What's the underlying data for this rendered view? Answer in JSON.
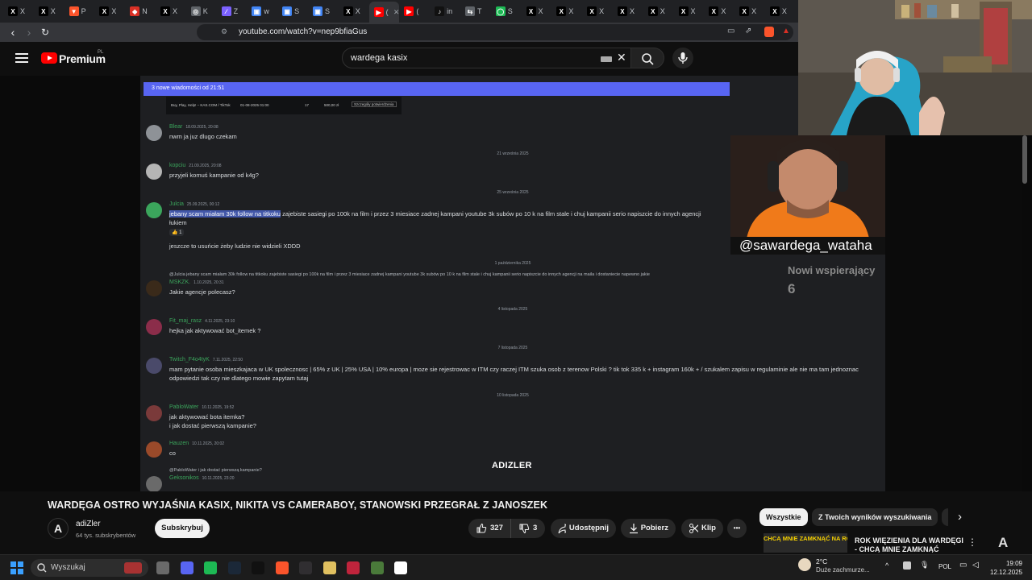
{
  "browser": {
    "tabs": [
      {
        "icon": "x-icon",
        "label": "X",
        "color": "#000000",
        "glyph": "X"
      },
      {
        "icon": "x-icon",
        "label": "X",
        "color": "#000000",
        "glyph": "X"
      },
      {
        "icon": "brave-icon",
        "label": "P",
        "color": "#fb542b",
        "glyph": "▼"
      },
      {
        "icon": "x-icon",
        "label": "X",
        "color": "#000000",
        "glyph": "X"
      },
      {
        "icon": "shield-icon",
        "label": "N",
        "color": "#d93025",
        "glyph": "◆"
      },
      {
        "icon": "x-icon",
        "label": "X",
        "color": "#000000",
        "glyph": "X"
      },
      {
        "icon": "globe-icon",
        "label": "K",
        "color": "#5f6368",
        "glyph": "◎"
      },
      {
        "icon": "pencil-icon",
        "label": "Z",
        "color": "#7b61ff",
        "glyph": "∕"
      },
      {
        "icon": "tool-icon",
        "label": "w",
        "color": "#4285f4",
        "glyph": "▣"
      },
      {
        "icon": "tool-icon",
        "label": "S",
        "color": "#4285f4",
        "glyph": "▣"
      },
      {
        "icon": "tool-icon",
        "label": "S",
        "color": "#4285f4",
        "glyph": "▣"
      },
      {
        "icon": "x-icon",
        "label": "X",
        "color": "#000000",
        "glyph": "X"
      },
      {
        "icon": "youtube-icon",
        "label": "(",
        "color": "#ff0000",
        "glyph": "▶",
        "active": true
      },
      {
        "icon": "youtube-icon",
        "label": "(",
        "color": "#ff0000",
        "glyph": "▶"
      },
      {
        "icon": "tiktok-icon",
        "label": "in",
        "color": "#111111",
        "glyph": "♪"
      },
      {
        "icon": "arrows-icon",
        "label": "T",
        "color": "#5f6368",
        "glyph": "⇆"
      },
      {
        "icon": "circle-icon",
        "label": "S",
        "color": "#1db954",
        "glyph": "◯"
      },
      {
        "icon": "x-icon",
        "label": "X",
        "color": "#000000",
        "glyph": "X"
      },
      {
        "icon": "x-icon",
        "label": "X",
        "color": "#000000",
        "glyph": "X"
      },
      {
        "icon": "x-icon",
        "label": "X",
        "color": "#000000",
        "glyph": "X"
      },
      {
        "icon": "x-icon",
        "label": "X",
        "color": "#000000",
        "glyph": "X"
      },
      {
        "icon": "x-icon",
        "label": "X",
        "color": "#000000",
        "glyph": "X"
      },
      {
        "icon": "x-icon",
        "label": "X",
        "color": "#000000",
        "glyph": "X"
      },
      {
        "icon": "x-icon",
        "label": "X",
        "color": "#000000",
        "glyph": "X"
      },
      {
        "icon": "x-icon",
        "label": "X",
        "color": "#000000",
        "glyph": "X"
      },
      {
        "icon": "x-icon",
        "label": "X",
        "color": "#000000",
        "glyph": "X"
      }
    ],
    "url": "youtube.com/watch?v=nep9bfiaGus"
  },
  "youtube": {
    "brand": "Premium",
    "region": "PL",
    "search_value": "wardega kasix",
    "video_title": "WARDĘGA OSTRO WYJAŚNIA KASIX, NIKITA VS CAMERABOY, STANOWSKI PRZEGRAŁ Z JANOSZEK",
    "channel_avatar_letter": "A",
    "channel_name": "adiZler",
    "subscribers": "64 tys. subskrybentów",
    "subscribe_label": "Subskrybuj",
    "likes": "327",
    "dislikes": "3",
    "share_label": "Udostępnij",
    "download_label": "Pobierz",
    "clip_label": "Klip",
    "more_label": "•••",
    "chips": [
      "Wszystkie",
      "Z Twoich wyników wyszukiwania"
    ],
    "reco_thumb_text": "CHCĄ MNIE ZAMKNĄĆ NA ROK",
    "reco_title": "ROK WIĘZIENIA DLA WARDĘGI - CHCĄ MNIE ZAMKNĄĆ"
  },
  "video": {
    "new_messages_banner": "3 nowe wiadomości od 21:51",
    "embed": {
      "col1": "Buy, Play, Help! – KAS.COM / TikTok",
      "col2": "01-08-2025 01:00",
      "col3": "17",
      "col4": "500,00 zł",
      "col5": "Szczegóły potwierdzenia"
    },
    "watermark": "ADIZLER",
    "messages": [
      {
        "user": "Blear",
        "time": "18.09.2025, 20:08",
        "text": "nwm ja juz dlugo czekam",
        "avatar_color": "#8e9297"
      },
      {
        "sep": "21 września 2025"
      },
      {
        "user": "kopciu",
        "time": "21.09.2025, 20:08",
        "text": "przyjeli komuś kampanie od k4g?",
        "avatar_color": "#b5b5b5"
      },
      {
        "sep": "25 września 2025"
      },
      {
        "user": "Julcia",
        "time": "25.09.2025, 00:12",
        "highlight": "jebany scam miałam 30k follow na titkoku",
        "text": " zajebiste sasiegi po 100k na film i przez 3 miesiace zadnej kampani youtube 3k subów po 10 k na film stale i chuj kampanii serio napiszcie do innych agencji",
        "text2": "łukiem",
        "reaction": "👍 1",
        "extra": "jeszcze to usuńcie żeby ludzie nie widzieli XDDD",
        "avatar_color": "#3ba55c"
      },
      {
        "sep": "1 października 2025"
      },
      {
        "reply": "@Julcia jebany scam miałam 30k follow na titkoku zajebiste sasiegi po 100k na film i przez 3 miesiace zadnej kampani youtube 3k subów po 10 k na film stale i chuj kampanii serio napiszcie do innych agencji na maila i dostaniecie napewno jakie",
        "user": "MSKZK.",
        "time": "1.10.2025, 20:31",
        "text": "Jakie agencje polecasz?",
        "avatar_color": "#3a2a1a"
      },
      {
        "sep": "4 listopada 2025"
      },
      {
        "user": "Fit_maj_rasz",
        "time": "4.11.2025, 23:10",
        "text": "hejka jak aktywować bot_itemek ?",
        "avatar_color": "#8b2d4a"
      },
      {
        "sep": "7 listopada 2025"
      },
      {
        "user": "Twitch_F4o4tyK",
        "time": "7.11.2025, 22:50",
        "text": "mam pytanie osoba mieszkajaca w UK spolecznosc | 65%  z UK | 25%  USA | 10% europa | moze sie rejestrowac w ITM czy raczej ITM szuka osob z terenow Polski ? tik tok 335 k + instagram 160k + / szukalem zapisu w regulaminie ale nie ma tam jednoznac",
        "text2": "odpowiedzi tak czy nie dlatego mowie zapytam tutaj",
        "avatar_color": "#4a4a6a"
      },
      {
        "sep": "10 listopada 2025"
      },
      {
        "user": "PabloWater",
        "time": "10.11.2025, 19:52",
        "text": "jak aktywować bota itemka?",
        "text2": "i jak dostać pierwszą kampanie?",
        "avatar_color": "#7a3a3a"
      },
      {
        "user": "Hauzen",
        "time": "10.11.2025, 20:02",
        "text": "co",
        "avatar_color": "#9a4a2a"
      },
      {
        "reply": "@PabloWater i jak dostać pierwszą kampanie?",
        "user": "Geksonikos",
        "time": "10.11.2025, 23:20",
        "avatar_color": "#6a6a6a"
      }
    ]
  },
  "stream": {
    "handle": "@sawardega_wataha",
    "supporters_label": "Nowi wspierający",
    "supporters_count": "6",
    "overlay_letter": "A"
  },
  "taskbar": {
    "search_placeholder": "Wyszukaj",
    "weather_temp": "2°C",
    "weather_desc": "Duże zachmurze...",
    "lang": "POL",
    "time": "19:09",
    "date": "12.12.2025",
    "apps": [
      {
        "name": "task-view-icon",
        "color": "#6a6a6a"
      },
      {
        "name": "discord-icon",
        "color": "#5865f2"
      },
      {
        "name": "spotify-icon",
        "color": "#1db954"
      },
      {
        "name": "steam-icon",
        "color": "#1b2838"
      },
      {
        "name": "app-g-icon",
        "color": "#111111"
      },
      {
        "name": "brave-icon",
        "color": "#fb542b"
      },
      {
        "name": "obs-icon",
        "color": "#302e31"
      },
      {
        "name": "shield-app-icon",
        "color": "#e0c060"
      },
      {
        "name": "k-app-icon",
        "color": "#c0243c"
      },
      {
        "name": "l-app-icon",
        "color": "#4a7a3a"
      },
      {
        "name": "panda-icon",
        "color": "#ffffff"
      }
    ]
  },
  "colors": {
    "youtube_red": "#ff0000",
    "discord_blurple": "#5865f2",
    "discord_bg": "#1e1f22",
    "username_green": "#3ba55c"
  }
}
